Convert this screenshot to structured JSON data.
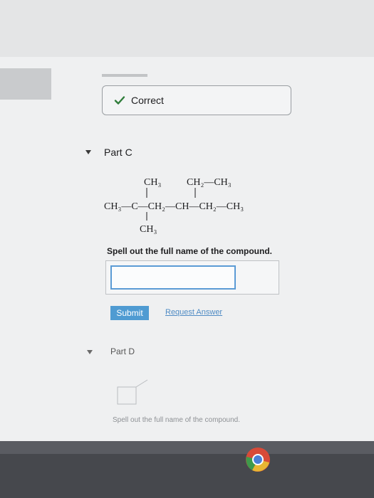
{
  "status": {
    "correct_label": "Correct"
  },
  "part_c": {
    "label": "Part C",
    "molecule": {
      "top_left": "CH₃",
      "top_right": "CH₂—CH₃",
      "main_chain": "CH₃—C—CH₂—CH—CH₂—CH₃",
      "bottom": "CH₃"
    },
    "prompt": "Spell out the full name of the compound.",
    "answer_value": "",
    "submit_label": "Submit",
    "request_answer_label": "Request Answer"
  },
  "part_d": {
    "label": "Part D",
    "prompt": "Spell out the full name of the compound."
  },
  "colors": {
    "accent": "#4f9bd2",
    "check": "#2f7d3a",
    "taskbar": "#46484d"
  },
  "icons": [
    "check-icon",
    "expand-arrow-icon",
    "chrome-icon"
  ]
}
